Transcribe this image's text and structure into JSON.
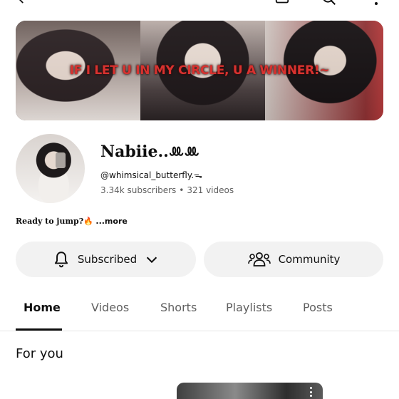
{
  "topbar": {
    "icons": [
      "back-arrow-icon",
      "cast-icon",
      "search-icon",
      "more-vert-icon"
    ]
  },
  "banner": {
    "tagline": "IF I LET U IN MY CIRCLE, U A WINNER!~"
  },
  "channel": {
    "name": "Nabiie..ꔛꔛ",
    "handle": "@whimsical_butterfly.ᯓ",
    "subscribers": "3.34k subscribers",
    "videos": "321 videos",
    "separator": "•"
  },
  "description": {
    "text": "Ready to jump?🔥",
    "more": "...more"
  },
  "buttons": {
    "subscribed_label": "Subscribed",
    "community_label": "Community"
  },
  "tabs": [
    {
      "label": "Home",
      "active": true
    },
    {
      "label": "Videos",
      "active": false
    },
    {
      "label": "Shorts",
      "active": false
    },
    {
      "label": "Playlists",
      "active": false
    },
    {
      "label": "Posts",
      "active": false
    }
  ],
  "section": {
    "title": "For you"
  },
  "colors": {
    "button_bg": "#f2f2f2",
    "text_primary": "#0f0f0f",
    "text_secondary": "#606060",
    "tagline_red": "#d8322f"
  }
}
